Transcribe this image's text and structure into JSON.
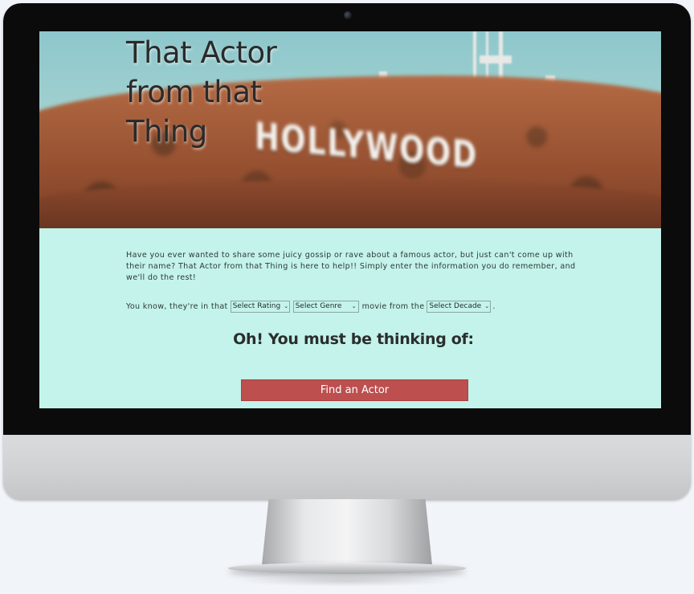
{
  "hero": {
    "title_line1": "That Actor",
    "title_line2": "from that",
    "title_line3": "Thing",
    "background_sign": "HOLLYWOOD"
  },
  "intro": {
    "text": "Have you ever wanted to share some juicy gossip or rave about a famous actor, but just can't come up with their name? That Actor from that Thing is here to help!! Simply enter the information you do remember, and we'll do the rest!"
  },
  "question": {
    "prefix": "You know, they're in that",
    "middle": "movie from the",
    "suffix": ".",
    "rating_select": "Select Rating",
    "genre_select": "Select Genre",
    "decade_select": "Select Decade"
  },
  "result": {
    "heading": "Oh! You must be thinking of:"
  },
  "actions": {
    "find_button": "Find an Actor"
  },
  "colors": {
    "page_background": "#c3f3ea",
    "button": "#bd4f4f",
    "text": "#2e3a38"
  },
  "icons": {
    "select_chevron": "chevron-down-icon",
    "camera": "camera-icon"
  }
}
